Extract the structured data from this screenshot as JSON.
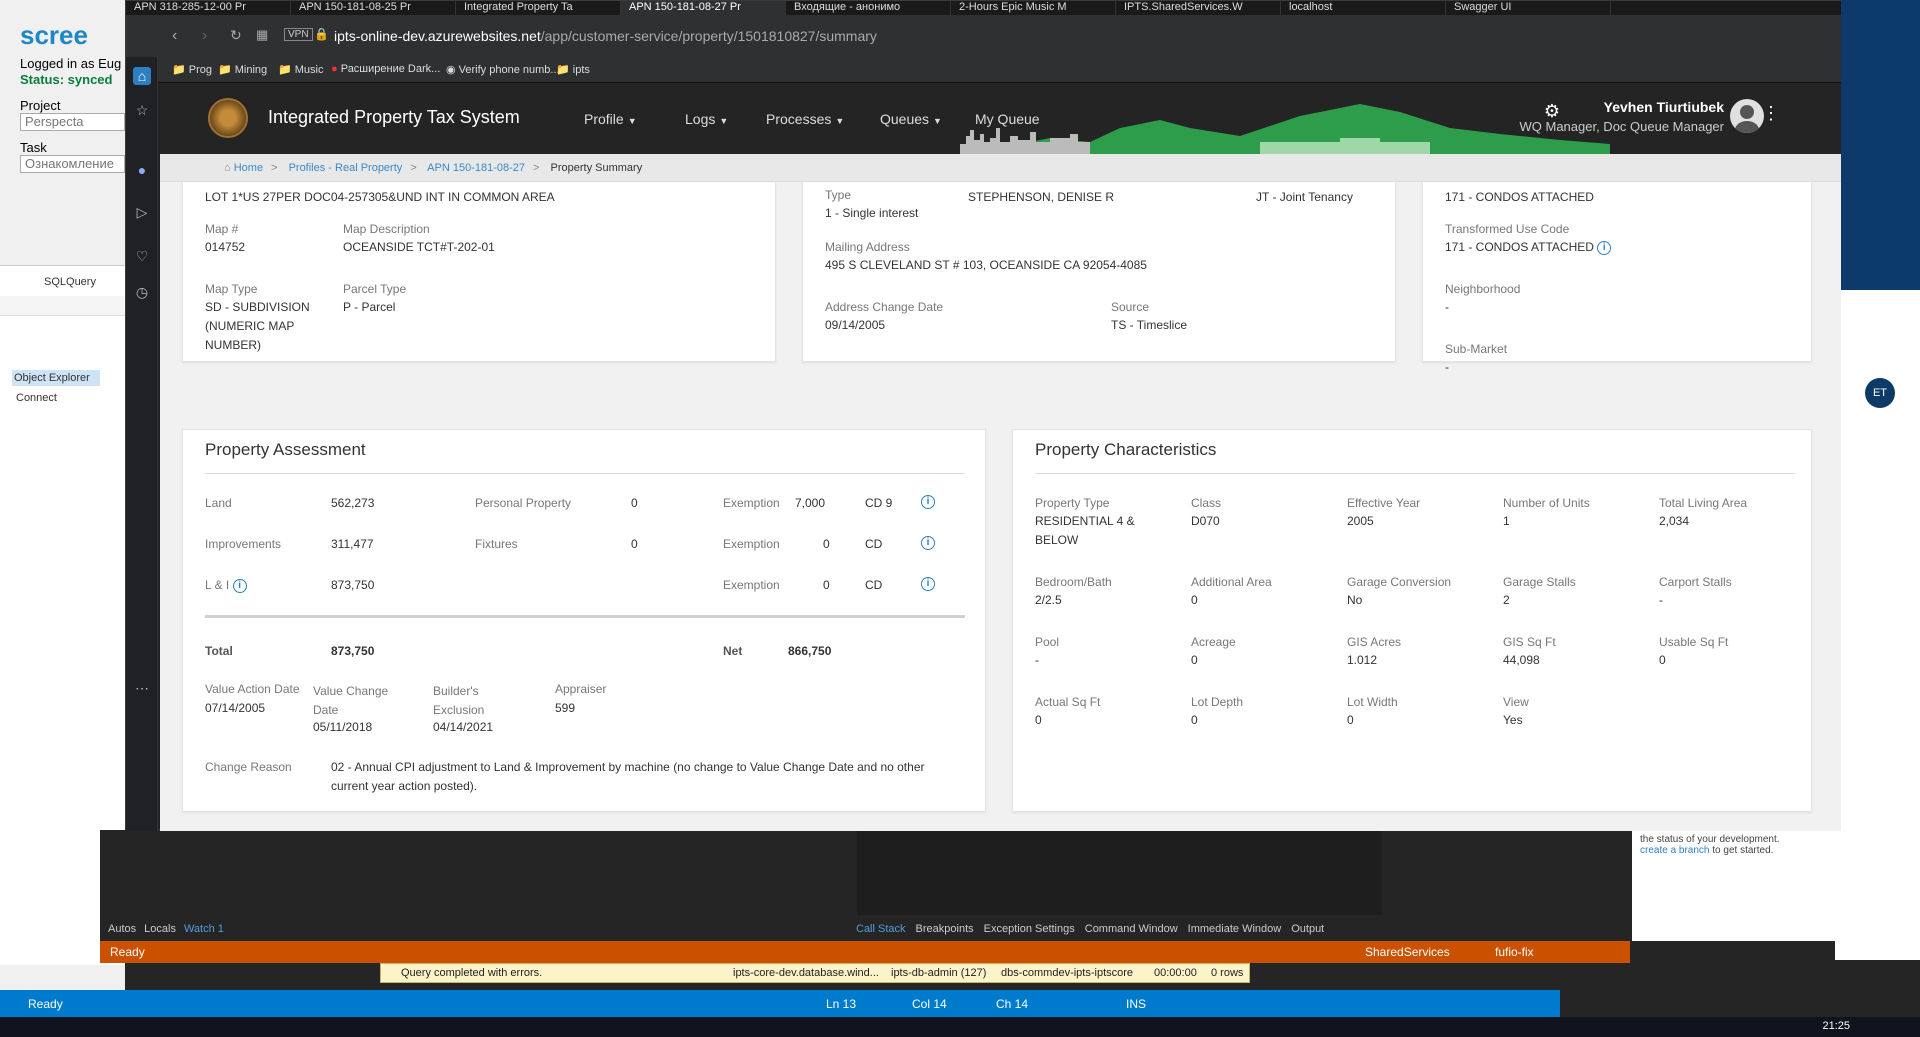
{
  "browser": {
    "tabs": [
      {
        "label": "APN 318-285-12-00 Pr"
      },
      {
        "label": "APN 150-181-08-25 Pr"
      },
      {
        "label": "Integrated Property Ta"
      },
      {
        "label": "APN 150-181-08-27 Pr"
      },
      {
        "label": "Входящие - анонимо"
      },
      {
        "label": "2-Hours Epic Music M"
      },
      {
        "label": "IPTS.SharedServices.W"
      },
      {
        "label": "localhost"
      },
      {
        "label": "Swagger UI"
      }
    ],
    "active_tab": 3,
    "vpn_badge": "VPN",
    "url_host": "ipts-online-dev.azurewebsites.net",
    "url_path": "/app/customer-service/property/1501810827/summary",
    "bookmarks": [
      "Prog",
      "Mining",
      "Music",
      "Расширение Dark...",
      "Verify phone numb...",
      "ipts"
    ]
  },
  "app": {
    "title": "Integrated Property Tax System",
    "nav": [
      "Profile",
      "Logs",
      "Processes",
      "Queues",
      "My Queue"
    ],
    "user_name": "Yevhen Tiurtiubek",
    "user_role": "WQ Manager, Doc Queue Manager",
    "breadcrumb": [
      "Home",
      "Profiles - Real Property",
      "APN 150-181-08-27",
      "Property Summary"
    ]
  },
  "legal": {
    "description": "LOT 1*US 27PER DOC04-257305&UND INT IN COMMON AREA",
    "map_no_label": "Map #",
    "map_no": "014752",
    "map_desc_label": "Map Description",
    "map_desc": "OCEANSIDE TCT#T-202-01",
    "map_type_label": "Map Type",
    "map_type": "SD - SUBDIVISION (NUMERIC MAP NUMBER)",
    "parcel_type_label": "Parcel Type",
    "parcel_type": "P - Parcel"
  },
  "owner": {
    "type_label": "Type",
    "type": "1 - Single interest",
    "name": "STEPHENSON, DENISE R",
    "tenancy": "JT - Joint Tenancy",
    "mailing_label": "Mailing Address",
    "mailing": "495 S CLEVELAND ST # 103, OCEANSIDE CA 92054-4085",
    "addr_change_label": "Address Change Date",
    "addr_change": "09/14/2005",
    "source_label": "Source",
    "source": "TS - Timeslice"
  },
  "usecode": {
    "use_code": "171 - CONDOS ATTACHED",
    "transformed_label": "Transformed Use Code",
    "transformed": "171 - CONDOS ATTACHED",
    "neighborhood_label": "Neighborhood",
    "neighborhood": "-",
    "submarket_label": "Sub-Market",
    "submarket": "-"
  },
  "assessment": {
    "title": "Property Assessment",
    "land_label": "Land",
    "land": "562,273",
    "impr_label": "Improvements",
    "impr": "311,477",
    "li_label": "L & I",
    "li": "873,750",
    "pp_label": "Personal Property",
    "pp": "0",
    "fix_label": "Fixtures",
    "fix": "0",
    "exemptions": [
      {
        "label": "Exemption",
        "amount": "7,000",
        "code": "CD 9"
      },
      {
        "label": "Exemption",
        "amount": "0",
        "code": "CD"
      },
      {
        "label": "Exemption",
        "amount": "0",
        "code": "CD"
      }
    ],
    "total_label": "Total",
    "total": "873,750",
    "net_label": "Net",
    "net": "866,750",
    "vad_label": "Value Action Date",
    "vad": "07/14/2005",
    "vcd_label": "Value Change Date",
    "vcd": "05/11/2018",
    "be_label": "Builder's Exclusion",
    "be": "04/14/2021",
    "appraiser_label": "Appraiser",
    "appraiser": "599",
    "change_reason_label": "Change Reason",
    "change_reason": "02 - Annual CPI adjustment to Land & Improvement by machine (no change to Value Change Date and no other current year action posted)."
  },
  "characteristics": {
    "title": "Property Characteristics",
    "fields": [
      {
        "label": "Property Type",
        "value": "RESIDENTIAL 4 & BELOW"
      },
      {
        "label": "Class",
        "value": "D070"
      },
      {
        "label": "Effective Year",
        "value": "2005"
      },
      {
        "label": "Number of Units",
        "value": "1"
      },
      {
        "label": "Total Living Area",
        "value": "2,034"
      },
      {
        "label": "Bedroom/Bath",
        "value": "2/2.5"
      },
      {
        "label": "Additional Area",
        "value": "0"
      },
      {
        "label": "Garage Conversion",
        "value": "No"
      },
      {
        "label": "Garage Stalls",
        "value": "2"
      },
      {
        "label": "Carport Stalls",
        "value": "-"
      },
      {
        "label": "Pool",
        "value": "-"
      },
      {
        "label": "Acreage",
        "value": "0"
      },
      {
        "label": "GIS Acres",
        "value": "1.012"
      },
      {
        "label": "GIS Sq Ft",
        "value": "44,098"
      },
      {
        "label": "Usable Sq Ft",
        "value": "0"
      },
      {
        "label": "Actual Sq Ft",
        "value": "0"
      },
      {
        "label": "Lot Depth",
        "value": "0"
      },
      {
        "label": "Lot Width",
        "value": "0"
      },
      {
        "label": "View",
        "value": "Yes"
      }
    ]
  },
  "background": {
    "screen_logo": "scree",
    "logged_in": "Logged in as Eug",
    "status": "Status: synced",
    "project_label": "Project",
    "project_value": "Perspecta",
    "task_label": "Task",
    "task_value": "Ознакомление",
    "ssms_title": "SQLQuery",
    "object_explorer": "Object Explorer",
    "connect": "Connect",
    "debug_tabs": [
      "Autos",
      "Locals",
      "Watch 1"
    ],
    "debug_tabs_right": [
      "Call Stack",
      "Breakpoints",
      "Exception Settings",
      "Command Window",
      "Immediate Window",
      "Output"
    ],
    "orange_ready": "Ready",
    "orange_branch": "SharedServices",
    "orange_fix": "fufio-fix",
    "query_status": "Query completed with errors.",
    "query_server": "ipts-core-dev.database.wind...",
    "query_user": "ipts-db-admin (127)",
    "query_db": "dbs-commdev-ipts-iptscore",
    "query_time": "00:00:00",
    "query_rows": "0 rows",
    "status_ready": "Ready",
    "ln": "Ln 13",
    "col": "Col 14",
    "ch": "Ch 14",
    "ins": "INS",
    "clock": "21:25",
    "right_hint": "the status of your development.",
    "right_link": "create a branch",
    "right_link_tail": "to get started.",
    "avatar_initials": "ET"
  },
  "colors": {
    "accent": "#2d7fc1",
    "header": "#242424",
    "vs_blue": "#007acc",
    "vs_orange": "#ca5100"
  }
}
